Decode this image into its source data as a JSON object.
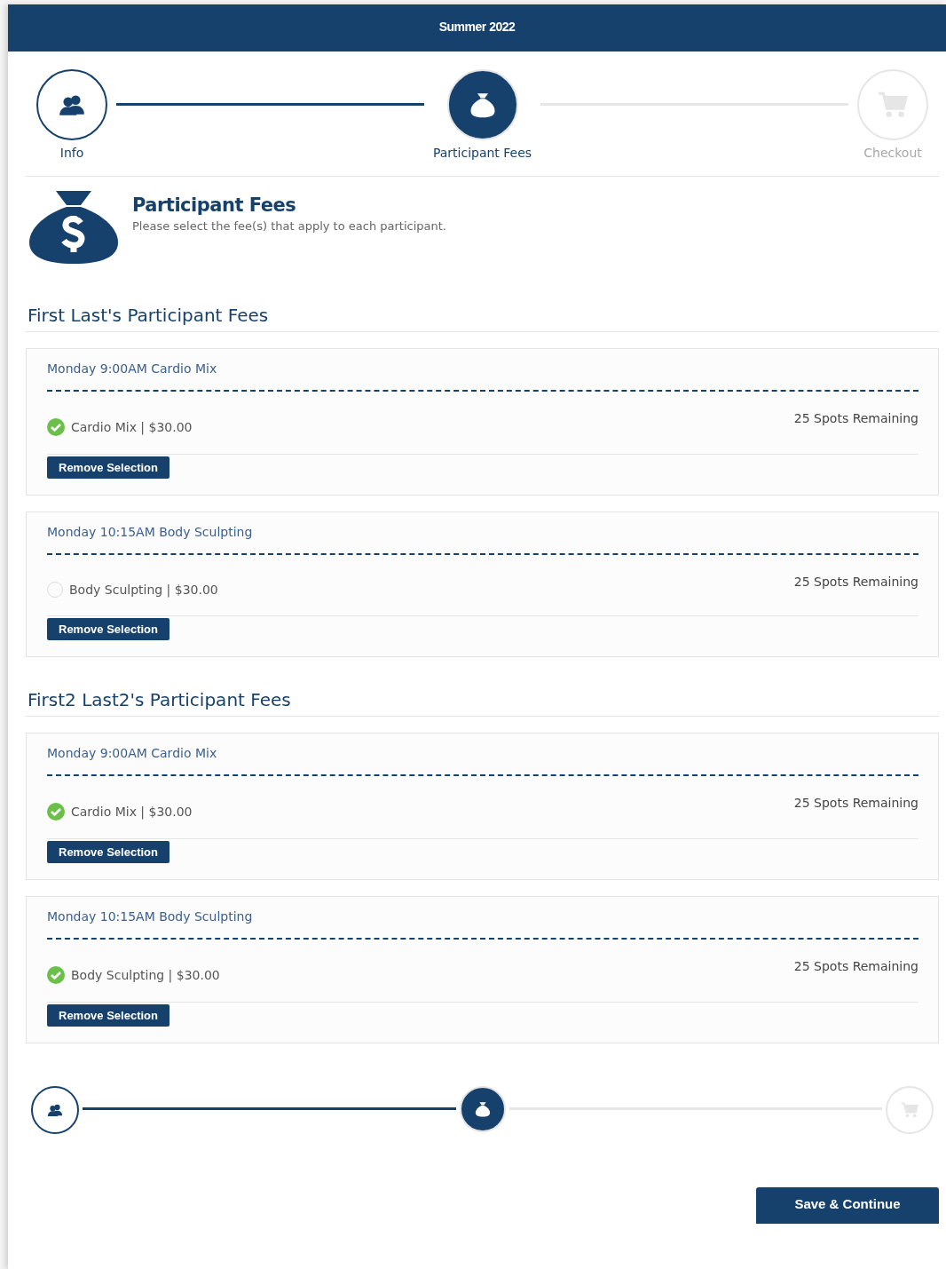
{
  "header": {
    "title": "Summer 2022"
  },
  "steps": [
    {
      "kind": "people",
      "label": "Info",
      "done": true,
      "selected": false
    },
    {
      "kind": "bag",
      "label": "Participant Fees",
      "done": true,
      "selected": true
    },
    {
      "kind": "cart",
      "label": "Checkout",
      "done": false,
      "selected": false
    }
  ],
  "intro": {
    "title": "Participant Fees",
    "text": "Please select the fee(s) that apply to each participant."
  },
  "participants": [
    {
      "heading": "First Last's Participant Fees",
      "sessions": [
        {
          "title": "Monday 9:00AM Cardio Mix",
          "option": "Cardio Mix | $30.00",
          "selected": true,
          "spots": "25 Spots Remaining",
          "button": "Remove Selection"
        },
        {
          "title": "Monday 10:15AM Body Sculpting",
          "option": "Body Sculpting | $30.00",
          "selected": false,
          "spots": "25 Spots Remaining",
          "button": "Remove Selection"
        }
      ]
    },
    {
      "heading": "First2 Last2's Participant Fees",
      "sessions": [
        {
          "title": "Monday 9:00AM Cardio Mix",
          "option": "Cardio Mix | $30.00",
          "selected": true,
          "spots": "25 Spots Remaining",
          "button": "Remove Selection"
        },
        {
          "title": "Monday 10:15AM Body Sculpting",
          "option": "Body Sculpting | $30.00",
          "selected": true,
          "spots": "25 Spots Remaining",
          "button": "Remove Selection"
        }
      ]
    }
  ],
  "bottom_steps": [
    {
      "kind": "people",
      "done": true,
      "selected": false
    },
    {
      "kind": "bag",
      "done": true,
      "selected": true
    },
    {
      "kind": "cart",
      "done": false,
      "selected": false
    }
  ],
  "save_button": "Save & Continue"
}
